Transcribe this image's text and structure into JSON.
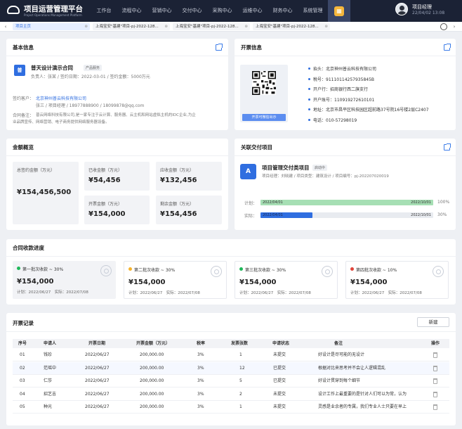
{
  "app": {
    "title": "项目运营管理平台",
    "subtitle": "Project Operations Management Platform"
  },
  "nav": {
    "items": [
      "工作台",
      "流程中心",
      "营销中心",
      "交付中心",
      "采购中心",
      "运维中心",
      "财务中心",
      "系统管理"
    ],
    "home_icon": "grid-icon"
  },
  "user": {
    "name": "项目经理",
    "datetime": "22/04/02 13:08"
  },
  "tabs": [
    {
      "label": "项目主页",
      "active": true
    },
    {
      "label": "上海宝安\"基建\"项目-pj-2022-128...",
      "active": false
    },
    {
      "label": "上海宝安\"基建\"项目-pj-2022-128...",
      "active": false
    },
    {
      "label": "上海宝安\"基建\"项目-pj-2022-128...",
      "active": false
    }
  ],
  "basic_info": {
    "title": "基本信息",
    "badge": "普",
    "contract_name": "普天设计演示合同",
    "tag": "产品服务",
    "meta": "负责人：张某 / 签约日期：2022-03-01 / 签约金额：5000万元",
    "customer_label": "签约客户：",
    "customer_name": "北京神州普云科技有限公司",
    "customer_contact": "张三 / 项目经理 / 18977888900 / 18099878@qq.com",
    "note_label": "合同备注：",
    "note_line1": "普云网络科技有限公司,是一家专注于云计算、服务器、云主机和网站虚拟主机的IDC企业,为企",
    "note_line2": "业品牌宣传、网络营销、电子商务提供网络服务器设备。"
  },
  "invoice_info": {
    "title": "开票信息",
    "qr_button": "开票可微信出示",
    "fields": [
      "抬头：北京神州普云科技有限公司",
      "税号：91110114257935845B",
      "开户行：招商银行西二旗支行",
      "开户账号：110919272610101",
      "地址：北京市昌平区科技园区超前路37号院16号楼2层C2407",
      "电话：010-57298019"
    ]
  },
  "amount_overview": {
    "title": "金额概览",
    "total_label": "总签约金额（万元）",
    "total_value": "¥154,456,500",
    "received_label": "已收金额（万元）",
    "received_value": "¥54,456",
    "receivable_label": "应收金额（万元）",
    "receivable_value": "¥132,456",
    "invoiced_label": "开票金额（万元）",
    "invoiced_value": "¥154,000",
    "remaining_label": "剩余金额（万元）",
    "remaining_value": "¥154,456"
  },
  "related_project": {
    "title": "关联交付项目",
    "badge": "A",
    "name": "项目管理交付类项目",
    "status": "启动中",
    "meta": "项目经理：刘晓建 / 项目类型：建筑设计 / 项目编号：pj-202207020019",
    "plan_label": "计划：",
    "plan_start": "2022/04/01",
    "plan_end": "2022/10/01",
    "plan_percent": "100%",
    "plan_fraction": 1.0,
    "actual_label": "实际：",
    "actual_start": "2022/04/01",
    "actual_end": "2022/10/01",
    "actual_percent": "30%",
    "actual_fraction": 0.3
  },
  "collection": {
    "title": "合同收款进度",
    "stages": [
      {
        "name": "第一批次收款 ~ 30%",
        "value": "¥154,000",
        "dates": "计划：2022/06/27　实际：2022/07/08",
        "color": "#1fb85a",
        "bg": "#f2f3f6"
      },
      {
        "name": "第二批次收款 ~ 30%",
        "value": "¥154,000",
        "dates": "计划：2022/06/27　实际：2022/07/08",
        "color": "#f5b32e",
        "bg": "#ffffff"
      },
      {
        "name": "第三批次收款 ~ 30%",
        "value": "¥154,000",
        "dates": "计划：2022/06/27　实际：2022/07/08",
        "color": "#1fb85a",
        "bg": "#ffffff"
      },
      {
        "name": "第四批次收款 ~ 10%",
        "value": "¥154,000",
        "dates": "计划：2022/06/27　实际：2022/07/08",
        "color": "#e0453b",
        "bg": "#ffffff"
      }
    ]
  },
  "invoices": {
    "title": "开票记录",
    "new_button": "新建",
    "headers": [
      "序号",
      "申请人",
      "开票日期",
      "开票金额（万元）",
      "税率",
      "发票张数",
      "申请状态",
      "备注",
      "操作"
    ],
    "rows": [
      [
        "01",
        "钱珍",
        "2022/06/27",
        "200,000.00",
        "3%",
        "1",
        "未提交",
        "好设计是尽可能的无设计"
      ],
      [
        "02",
        "范瑶中",
        "2022/06/27",
        "200,000.00",
        "3%",
        "12",
        "已提交",
        "根据对比来思考并不会让人逻辑混乱"
      ],
      [
        "03",
        "仁莎",
        "2022/06/27",
        "200,000.00",
        "3%",
        "5",
        "已提交",
        "好设计贯穿到每个细节"
      ],
      [
        "04",
        "招艺吉",
        "2022/06/27",
        "200,000.00",
        "3%",
        "2",
        "未提交",
        "设计工作上最重要的是针对人们可以为常，认为"
      ],
      [
        "05",
        "种光",
        "2022/06/27",
        "200,000.00",
        "3%",
        "1",
        "未提交",
        "灵感是业余者的专属，我们专业人士只要在早上"
      ]
    ]
  }
}
